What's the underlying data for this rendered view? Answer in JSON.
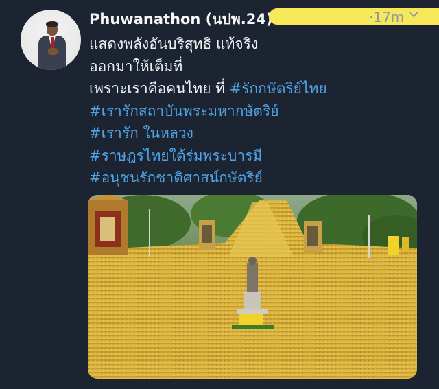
{
  "tweet": {
    "author": {
      "display_name": "Phuwanathon (นปพ.24)"
    },
    "time_ago": "·17m",
    "text_lines": {
      "l1": "แสดงพลังอันบริสุทธิ แท้จริง",
      "l2": "ออกมาให้เต็มที่",
      "l3_text": "เพราะเราคือคนไทย ที่ ",
      "l3_tag": "#รักกษัตริย์ไทย",
      "l4": "#เรารักสถาบันพระมหากษัตริย์",
      "l5": "#เรารัก ในหลวง",
      "l6": "#ราษฎรไทยใต้ร่มพระบารมี",
      "l7": "#อนุชนรักชาติศาสน์กษัตริย์"
    }
  },
  "colors": {
    "background": "#1b2430",
    "hashtag": "#4fa3e6",
    "redaction": "#f7e85a",
    "crowd": "#d8b33c"
  },
  "icons": {
    "menu": "chevron-down-icon"
  }
}
